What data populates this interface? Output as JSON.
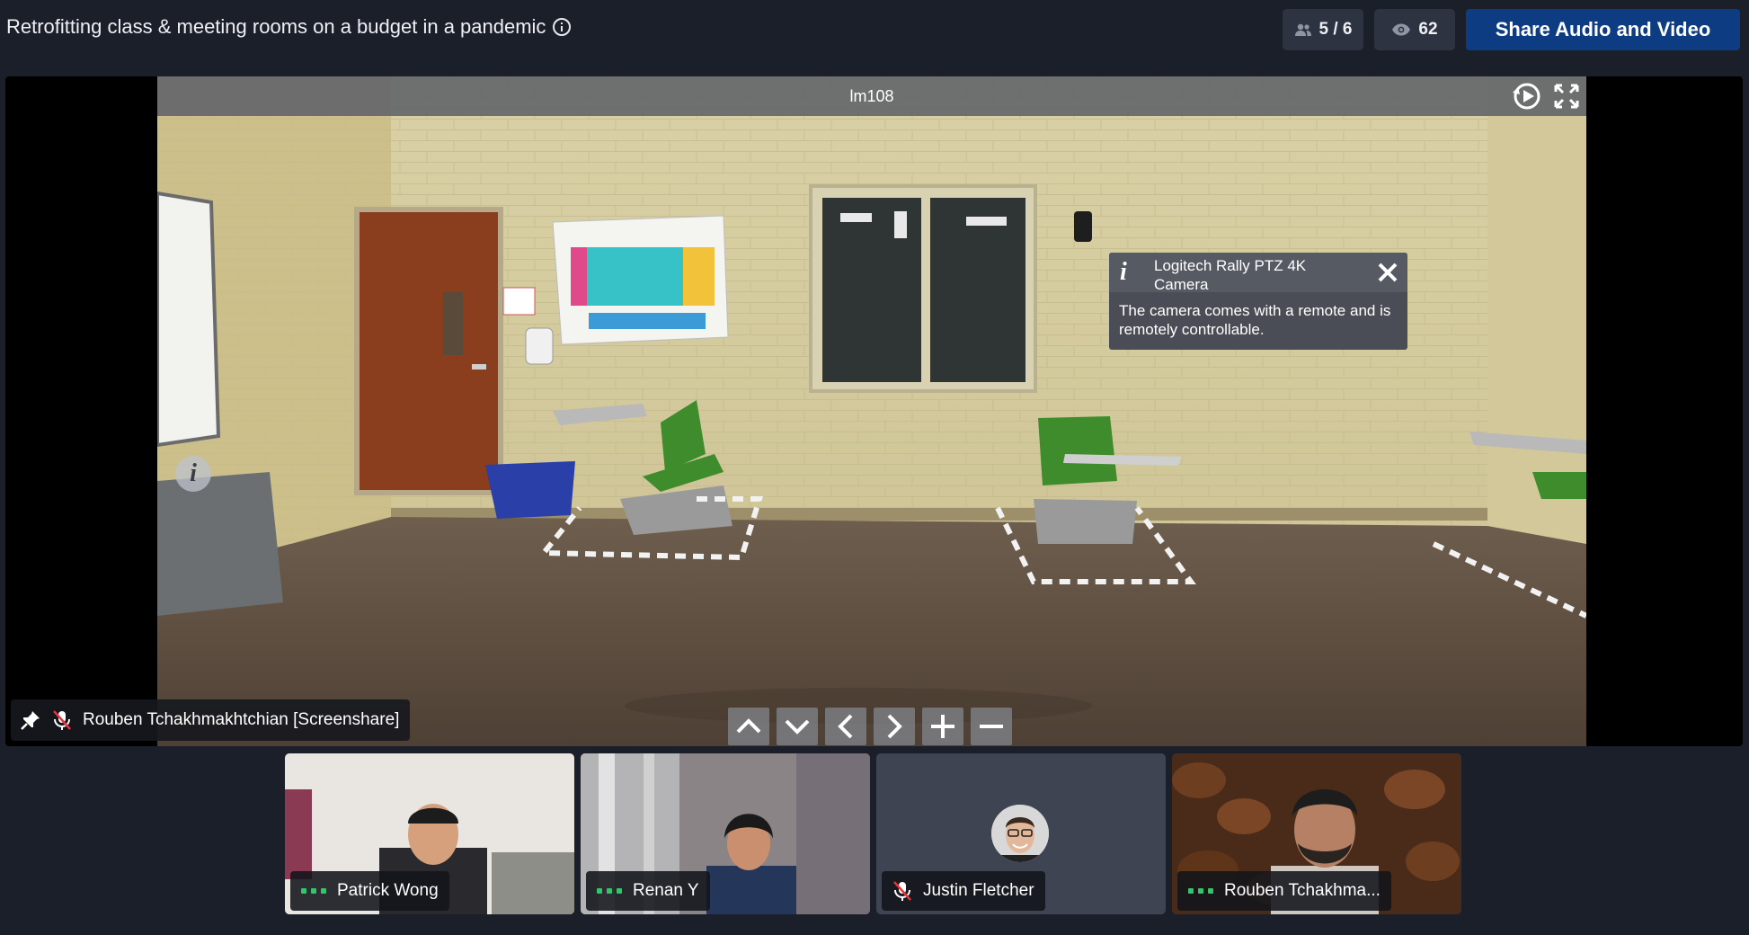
{
  "header": {
    "title": "Retrofitting class & meeting rooms on a budget in a pandemic",
    "participants_count": "5 / 6",
    "viewers_count": "62",
    "share_button": "Share Audio and Video"
  },
  "stage": {
    "viewer_title": "lm108",
    "hotspot_popup": {
      "title": "Logitech Rally PTZ 4K Camera",
      "body": "The camera comes with a remote and is remotely controllable."
    },
    "presenter_label": "Rouben Tchakhmakhtchian [Screenshare]",
    "nav_controls": [
      "up-arrow-icon",
      "down-arrow-icon",
      "left-arrow-icon",
      "right-arrow-icon",
      "zoom-in-icon",
      "zoom-out-icon"
    ]
  },
  "participants": [
    {
      "name": "Patrick Wong",
      "status": "speaking-dots"
    },
    {
      "name": "Renan Y",
      "status": "speaking-dots"
    },
    {
      "name": "Justin Fletcher",
      "status": "muted"
    },
    {
      "name": "Rouben Tchakhma...",
      "status": "speaking-dots"
    }
  ],
  "colors": {
    "background": "#1b1f2a",
    "share_button": "#0d3c82",
    "pill": "#2d3340",
    "speaking_dots": "#34c46a"
  }
}
